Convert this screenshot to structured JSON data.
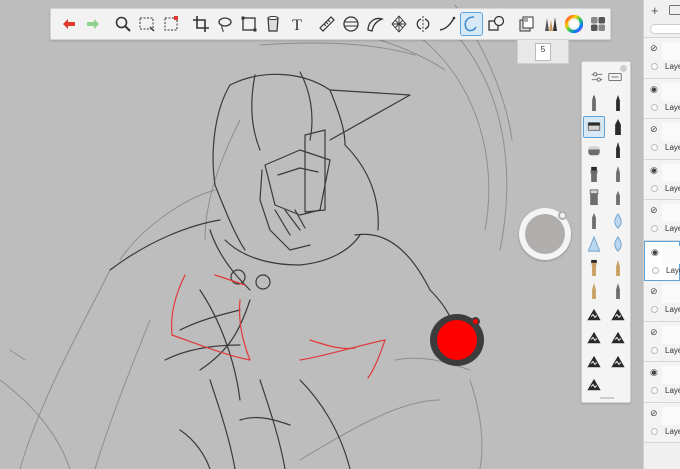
{
  "toolbar": {
    "tools": [
      {
        "icon": "undo-icon",
        "color": "#e03a2e"
      },
      {
        "icon": "redo-icon",
        "color": "#8fd18c"
      },
      {
        "icon": "zoom-icon"
      },
      {
        "icon": "rectangle-select-icon"
      },
      {
        "icon": "crop-select-icon"
      },
      {
        "icon": "crop-icon"
      },
      {
        "icon": "lasso-icon"
      },
      {
        "icon": "transform-icon"
      },
      {
        "icon": "fill-bucket-icon"
      },
      {
        "icon": "text-icon"
      },
      {
        "icon": "ruler-icon"
      },
      {
        "icon": "ellipse-guide-icon"
      },
      {
        "icon": "french-curve-icon"
      },
      {
        "icon": "perspective-icon"
      },
      {
        "icon": "symmetry-icon"
      },
      {
        "icon": "steady-stroke-icon"
      },
      {
        "icon": "predictive-stroke-icon",
        "active": true
      },
      {
        "icon": "shape-icon"
      },
      {
        "icon": "layer-editor-icon"
      },
      {
        "icon": "brush-library-icon"
      },
      {
        "icon": "color-wheel-icon"
      },
      {
        "icon": "copic-library-icon"
      }
    ]
  },
  "brush_size": {
    "value": "5"
  },
  "brush_panel": {
    "header_icons": [
      "brush-settings-icon",
      "brush-sets-icon"
    ],
    "brushes": [
      "pencil-brush-icon",
      "ballpoint-brush-icon",
      "airbrush-brush-icon",
      "marker-brush-icon",
      "chisel-brush-icon",
      "brush-pen-icon",
      "paint-brush-icon",
      "calligraphy-brush-icon",
      "eraser-brush-icon",
      "felt-tip-brush-icon",
      "smudge-brush-icon",
      "blur-brush-icon",
      "triangle-brush-icon",
      "water-drop-brush-icon",
      "flat-brush-icon",
      "fan-brush-icon",
      "round-brush-icon",
      "ink-brush-icon",
      "texture-brush-1-icon",
      "texture-brush-2-icon",
      "texture-brush-3-icon",
      "texture-brush-4-icon",
      "texture-brush-5-icon",
      "texture-brush-6-icon",
      "texture-brush-7-icon"
    ],
    "active_index": 2
  },
  "layers": {
    "rows": [
      {
        "label": "Laye",
        "visible": false
      },
      {
        "label": "Laye",
        "visible": true
      },
      {
        "label": "Laye",
        "visible": false
      },
      {
        "label": "Laye",
        "visible": true
      },
      {
        "label": "Laye",
        "visible": false
      },
      {
        "label": "Laye",
        "visible": true,
        "selected": true
      },
      {
        "label": "Laye",
        "visible": false
      },
      {
        "label": "Laye",
        "visible": false
      },
      {
        "label": "Laye",
        "visible": true
      },
      {
        "label": "Laye",
        "visible": false
      }
    ]
  },
  "pucks": {
    "grey_color": "#b0adad",
    "red_color": "#ff0000"
  }
}
